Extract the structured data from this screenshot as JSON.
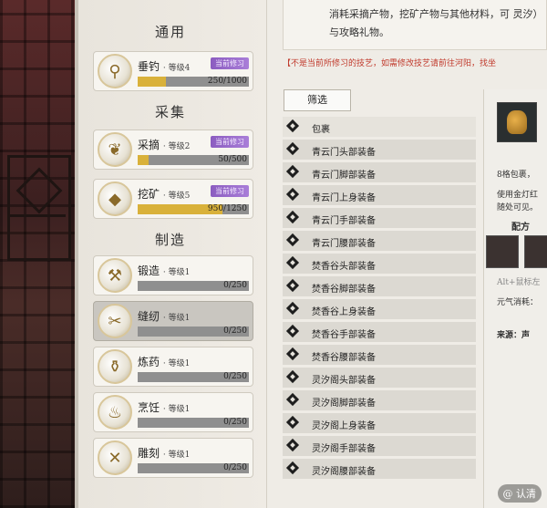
{
  "top_info": "消耗采摘产物，挖矿产物与其他材料，可 灵汐）与攻略礼物。",
  "warning": "【不是当前所修习的技艺，如需修改技艺请前往河阳，找坐",
  "sections": {
    "general": "通用",
    "gather": "采集",
    "craft": "制造"
  },
  "skills": [
    {
      "name": "垂钓",
      "level": "· 等级4",
      "badge": "当前修习",
      "progress": "250/1000",
      "ratio": 0.25
    },
    {
      "name": "采摘",
      "level": "· 等级2",
      "badge": "当前修习",
      "progress": "50/500",
      "ratio": 0.1
    },
    {
      "name": "挖矿",
      "level": "· 等级5",
      "badge": "当前修习",
      "progress": "950/1250",
      "ratio": 0.76
    },
    {
      "name": "锻造",
      "level": "· 等级1",
      "progress": "0/250",
      "ratio": 0
    },
    {
      "name": "缝纫",
      "level": "· 等级1",
      "progress": "0/250",
      "ratio": 0
    },
    {
      "name": "炼药",
      "level": "· 等级1",
      "progress": "0/250",
      "ratio": 0
    },
    {
      "name": "烹饪",
      "level": "· 等级1",
      "progress": "0/250",
      "ratio": 0
    },
    {
      "name": "雕刻",
      "level": "· 等级1",
      "progress": "0/250",
      "ratio": 0
    }
  ],
  "filter_label": "筛选",
  "recipes": [
    "包裹",
    "青云门头部装备",
    "青云门脚部装备",
    "青云门上身装备",
    "青云门手部装备",
    "青云门腰部装备",
    "焚香谷头部装备",
    "焚香谷脚部装备",
    "焚香谷上身装备",
    "焚香谷手部装备",
    "焚香谷腰部装备",
    "灵汐阁头部装备",
    "灵汐阁脚部装备",
    "灵汐阁上身装备",
    "灵汐阁手部装备",
    "灵汐阁腰部装备"
  ],
  "detail": {
    "line1": "8格包裹，",
    "line2": "使用金灯红",
    "line3": "随处可见。",
    "formula": "配方",
    "hint": "Alt+鼠标左",
    "cost": "元气消耗：",
    "source": "来源：声"
  },
  "watermark": "@ 认清"
}
